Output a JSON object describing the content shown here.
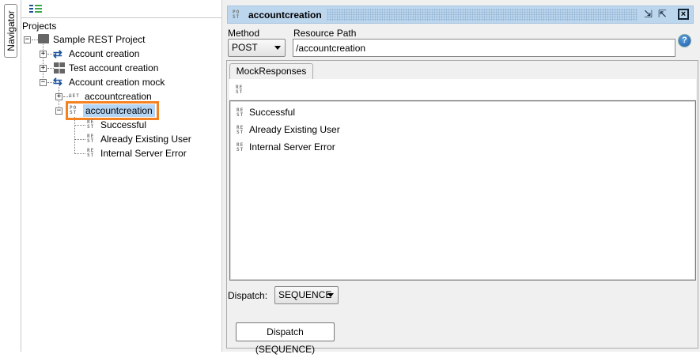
{
  "navigator": {
    "tab_label": "Navigator",
    "root_label": "Projects",
    "tree": [
      {
        "label": "Sample REST Project"
      },
      {
        "label": "Account creation"
      },
      {
        "label": "Test account creation"
      },
      {
        "label": "Account creation mock"
      },
      {
        "label": "accountcreation",
        "method": "GET"
      },
      {
        "label": "accountcreation",
        "method": "POST"
      },
      {
        "label": "Successful"
      },
      {
        "label": "Already Existing User"
      },
      {
        "label": "Internal Server Error"
      }
    ]
  },
  "editor": {
    "title": "accountcreation",
    "title_badge": "POST",
    "method_label": "Method",
    "method_value": "POST",
    "path_label": "Resource Path",
    "path_value": "/accountcreation",
    "tab_label": "MockResponses",
    "responses": [
      "Successful",
      "Already Existing User",
      "Internal Server Error"
    ],
    "dispatch_label": "Dispatch:",
    "dispatch_value": "SEQUENCE",
    "dispatch_button": "Dispatch (SEQUENCE)"
  },
  "colors": {
    "header": "#bcd6ee",
    "highlight": "#f58220",
    "selection": "#b5d5f5"
  }
}
